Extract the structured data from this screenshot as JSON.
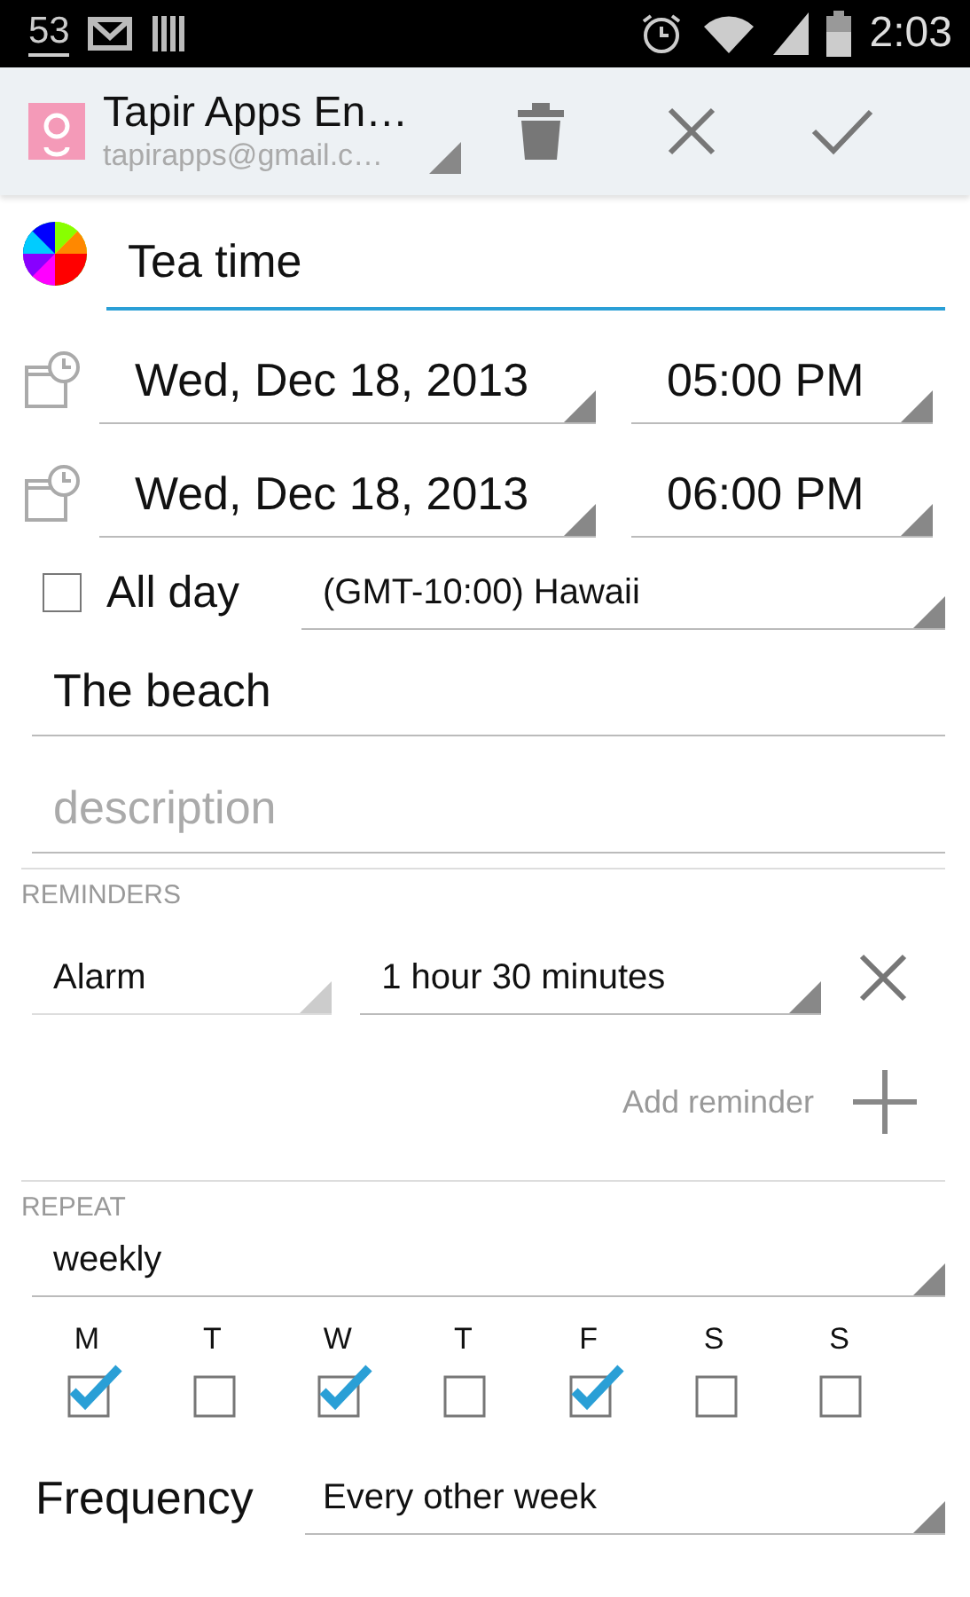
{
  "status_bar": {
    "notification_count": "53",
    "time": "2:03"
  },
  "account": {
    "name": "Tapir Apps En…",
    "email": "tapirapps@gmail.c…"
  },
  "title": {
    "value": "Tea time",
    "focused": true
  },
  "start": {
    "date": "Wed, Dec 18, 2013",
    "time": "05:00 PM"
  },
  "end": {
    "date": "Wed, Dec 18, 2013",
    "time": "06:00 PM"
  },
  "all_day": {
    "label": "All day",
    "checked": false
  },
  "timezone": "(GMT-10:00) Hawaii",
  "location": {
    "value": "The beach"
  },
  "description": {
    "placeholder": "description"
  },
  "reminders": {
    "heading": "REMINDERS",
    "items": [
      {
        "method": "Alarm",
        "time": "1 hour 30 minutes"
      }
    ],
    "add_label": "Add reminder"
  },
  "repeat": {
    "heading": "REPEAT",
    "value": "weekly",
    "days": [
      {
        "label": "M",
        "checked": true
      },
      {
        "label": "T",
        "checked": false
      },
      {
        "label": "W",
        "checked": true
      },
      {
        "label": "T",
        "checked": false
      },
      {
        "label": "F",
        "checked": true
      },
      {
        "label": "S",
        "checked": false
      },
      {
        "label": "S",
        "checked": false
      }
    ],
    "frequency_label": "Frequency",
    "frequency": "Every other week"
  }
}
